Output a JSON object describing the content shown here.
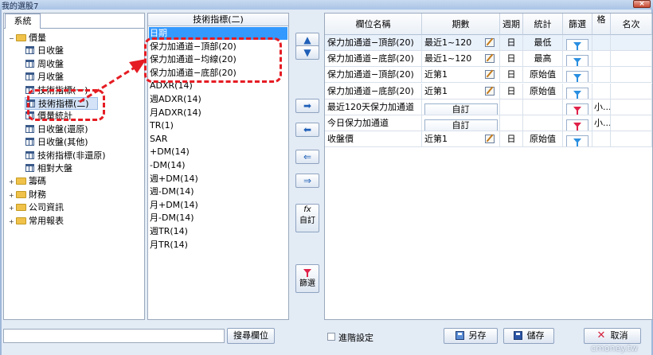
{
  "window": {
    "title": "我的選股7",
    "close_label": "×"
  },
  "left": {
    "tab_label": "系統",
    "tree": [
      {
        "label": "價量",
        "type": "folder",
        "expanded": true,
        "indent": 0,
        "exp": "−"
      },
      {
        "label": "日收盤",
        "type": "table",
        "indent": 1
      },
      {
        "label": "周收盤",
        "type": "table",
        "indent": 1
      },
      {
        "label": "月收盤",
        "type": "table",
        "indent": 1
      },
      {
        "label": "技術指標(一)",
        "type": "table",
        "indent": 1
      },
      {
        "label": "技術指標(二)",
        "type": "table",
        "indent": 1,
        "selected": true
      },
      {
        "label": "價量統計",
        "type": "table",
        "indent": 1
      },
      {
        "label": "日收盤(還原)",
        "type": "table",
        "indent": 1
      },
      {
        "label": "日收盤(其他)",
        "type": "table",
        "indent": 1
      },
      {
        "label": "技術指標(非還原)",
        "type": "table",
        "indent": 1
      },
      {
        "label": "相對大盤",
        "type": "table",
        "indent": 1
      },
      {
        "label": "籌碼",
        "type": "folder",
        "indent": 0,
        "exp": "+"
      },
      {
        "label": "財務",
        "type": "folder",
        "indent": 0,
        "exp": "+"
      },
      {
        "label": "公司資訊",
        "type": "folder",
        "indent": 0,
        "exp": "+"
      },
      {
        "label": "常用報表",
        "type": "folder",
        "indent": 0,
        "exp": "+"
      }
    ]
  },
  "middle": {
    "header": "技術指標(二)",
    "items": [
      "日期",
      "保力加通道−頂部(20)",
      "保力加通道−均線(20)",
      "保力加通道−底部(20)",
      "ADXR(14)",
      "週ADXR(14)",
      "月ADXR(14)",
      "TR(1)",
      "SAR",
      "+DM(14)",
      "-DM(14)",
      "週+DM(14)",
      "週-DM(14)",
      "月+DM(14)",
      "月-DM(14)",
      "週TR(14)",
      "月TR(14)"
    ]
  },
  "buttons": {
    "up": "▲",
    "down": "▼",
    "add": "➡",
    "remove": "⬅",
    "remove_all": "⇐",
    "add_all": "⇒",
    "custom_fx": "fx",
    "custom": "自訂",
    "filter": "篩選"
  },
  "grid": {
    "headers": [
      "欄位名稱",
      "期數",
      "週期",
      "統計",
      "篩選",
      "格",
      "名次"
    ],
    "rows": [
      {
        "name": "保力加通道−頂部(20)",
        "period": "最近1~120",
        "edit": true,
        "cycle": "日",
        "stat": "最低",
        "filter": "blue",
        "extra": ""
      },
      {
        "name": "保力加通道−底部(20)",
        "period": "最近1~120",
        "edit": true,
        "cycle": "日",
        "stat": "最高",
        "filter": "blue",
        "extra": ""
      },
      {
        "name": "保力加通道−頂部(20)",
        "period": "近第1",
        "edit": true,
        "cycle": "日",
        "stat": "原始值",
        "filter": "blue",
        "extra": ""
      },
      {
        "name": "保力加通道−底部(20)",
        "period": "近第1",
        "edit": true,
        "cycle": "日",
        "stat": "原始值",
        "filter": "blue",
        "extra": ""
      },
      {
        "name": "最近120天保力加通道",
        "period_button": "自訂",
        "cycle": "",
        "stat": "",
        "filter": "red",
        "extra": "小..."
      },
      {
        "name": "今日保力加通道",
        "period_button": "自訂",
        "cycle": "",
        "stat": "",
        "filter": "red",
        "extra": "小..."
      },
      {
        "name": "收盤價",
        "period": "近第1",
        "edit": true,
        "cycle": "日",
        "stat": "原始值",
        "filter": "blue",
        "extra": ""
      }
    ]
  },
  "bottom": {
    "search_placeholder": "",
    "search_button": "搜尋欄位",
    "advanced_label": "進階設定",
    "save_as": "另存",
    "save": "儲存",
    "cancel": "取消"
  },
  "watermark": "cmoney.tw",
  "colors": {
    "selection_blue": "#3399ff",
    "annotation_red": "#e51c23"
  }
}
